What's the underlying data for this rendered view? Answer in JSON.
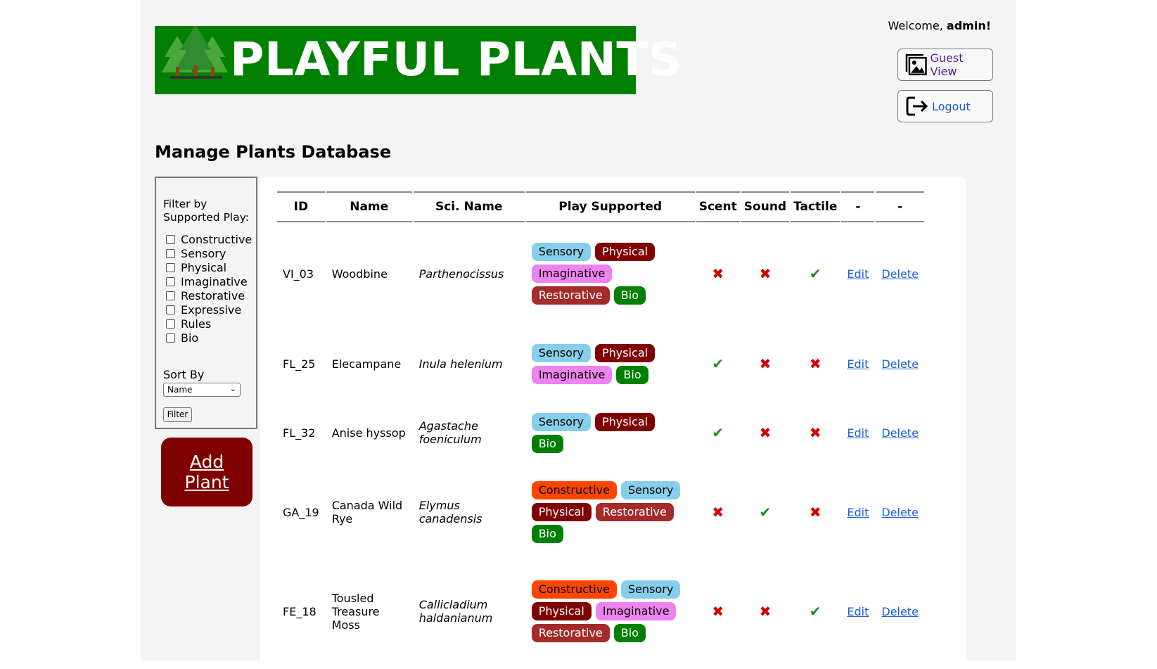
{
  "header": {
    "logo_text": "PLAYFUL PLANTS",
    "welcome_prefix": "Welcome, ",
    "welcome_user": "admin!",
    "guest_view_label": "Guest View",
    "logout_label": "Logout"
  },
  "page_title": "Manage Plants Database",
  "filter": {
    "heading": "Filter by Supported Play:",
    "options": [
      "Constructive",
      "Sensory",
      "Physical",
      "Imaginative",
      "Restorative",
      "Expressive",
      "Rules",
      "Bio"
    ],
    "sort_label": "Sort By",
    "sort_value": "Name",
    "filter_button": "Filter"
  },
  "add_plant": [
    "Add",
    "Plant"
  ],
  "table": {
    "headers": [
      "ID",
      "Name",
      "Sci. Name",
      "Play Supported",
      "Scent",
      "Sound",
      "Tactile",
      "-",
      "-"
    ],
    "rows": [
      {
        "id": "VI_03",
        "name": "Woodbine",
        "sci": "Parthenocissus",
        "play": [
          "Sensory",
          "Physical",
          "Imaginative",
          "Restorative",
          "Bio"
        ],
        "scent": false,
        "sound": false,
        "tactile": true,
        "edit": "Edit",
        "delete": "Delete"
      },
      {
        "id": "FL_25",
        "name": "Elecampane",
        "sci": "Inula helenium",
        "play": [
          "Sensory",
          "Physical",
          "Imaginative",
          "Bio"
        ],
        "scent": true,
        "sound": false,
        "tactile": false,
        "edit": "Edit",
        "delete": "Delete"
      },
      {
        "id": "FL_32",
        "name": "Anise hyssop",
        "sci": "Agastache foeniculum",
        "play": [
          "Sensory",
          "Physical",
          "Bio"
        ],
        "scent": true,
        "sound": false,
        "tactile": false,
        "edit": "Edit",
        "delete": "Delete"
      },
      {
        "id": "GA_19",
        "name": "Canada Wild Rye",
        "sci": "Elymus canadensis",
        "play": [
          "Constructive",
          "Sensory",
          "Physical",
          "Restorative",
          "Bio"
        ],
        "scent": false,
        "sound": true,
        "tactile": false,
        "edit": "Edit",
        "delete": "Delete"
      },
      {
        "id": "FE_18",
        "name": "Tousled Treasure Moss",
        "sci": "Callicladium haldanianum",
        "play": [
          "Constructive",
          "Sensory",
          "Physical",
          "Imaginative",
          "Restorative",
          "Bio"
        ],
        "scent": false,
        "sound": false,
        "tactile": true,
        "edit": "Edit",
        "delete": "Delete"
      }
    ]
  },
  "colors": {
    "logo_bg": "#008000",
    "add_plant_bg": "#800000",
    "Sensory": "#87ceeb",
    "Physical": "#800000",
    "Imaginative": "#ee82ee",
    "Restorative": "#a52a2a",
    "Bio": "#008000",
    "Constructive": "#ff4500"
  },
  "icons": {
    "yes": "check-icon",
    "no": "cross-icon",
    "guest": "picture-frame-icon",
    "logout": "logout-arrow-icon",
    "logo": "pine-trees-icon"
  }
}
